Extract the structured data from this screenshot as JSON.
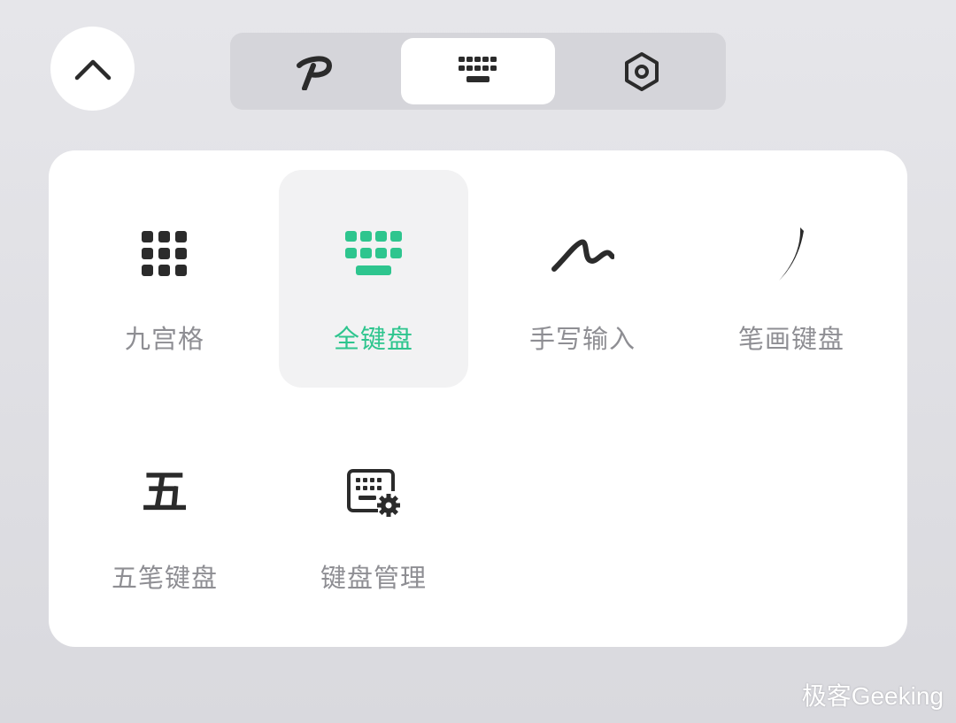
{
  "colors": {
    "accent": "#2ec58e",
    "icon_dark": "#2b2b2b",
    "label_gray": "#8e8e93",
    "panel": "#ffffff",
    "tab_track": "#d5d5da"
  },
  "header": {
    "collapse_icon": "chevron-up-icon",
    "tabs": [
      {
        "icon": "p-logo-icon",
        "selected": false
      },
      {
        "icon": "keyboard-icon",
        "selected": true
      },
      {
        "icon": "settings-hexagon-icon",
        "selected": false
      }
    ]
  },
  "input_methods": [
    {
      "label": "九宫格",
      "icon": "grid-nine-icon",
      "selected": false
    },
    {
      "label": "全键盘",
      "icon": "full-keyboard-icon",
      "selected": true
    },
    {
      "label": "手写输入",
      "icon": "handwriting-icon",
      "selected": false
    },
    {
      "label": "笔画键盘",
      "icon": "stroke-icon",
      "selected": false
    },
    {
      "label": "五笔键盘",
      "icon": "wubi-icon",
      "glyph": "五",
      "selected": false
    },
    {
      "label": "键盘管理",
      "icon": "keyboard-settings-icon",
      "selected": false
    }
  ],
  "watermark": "极客Geeking"
}
